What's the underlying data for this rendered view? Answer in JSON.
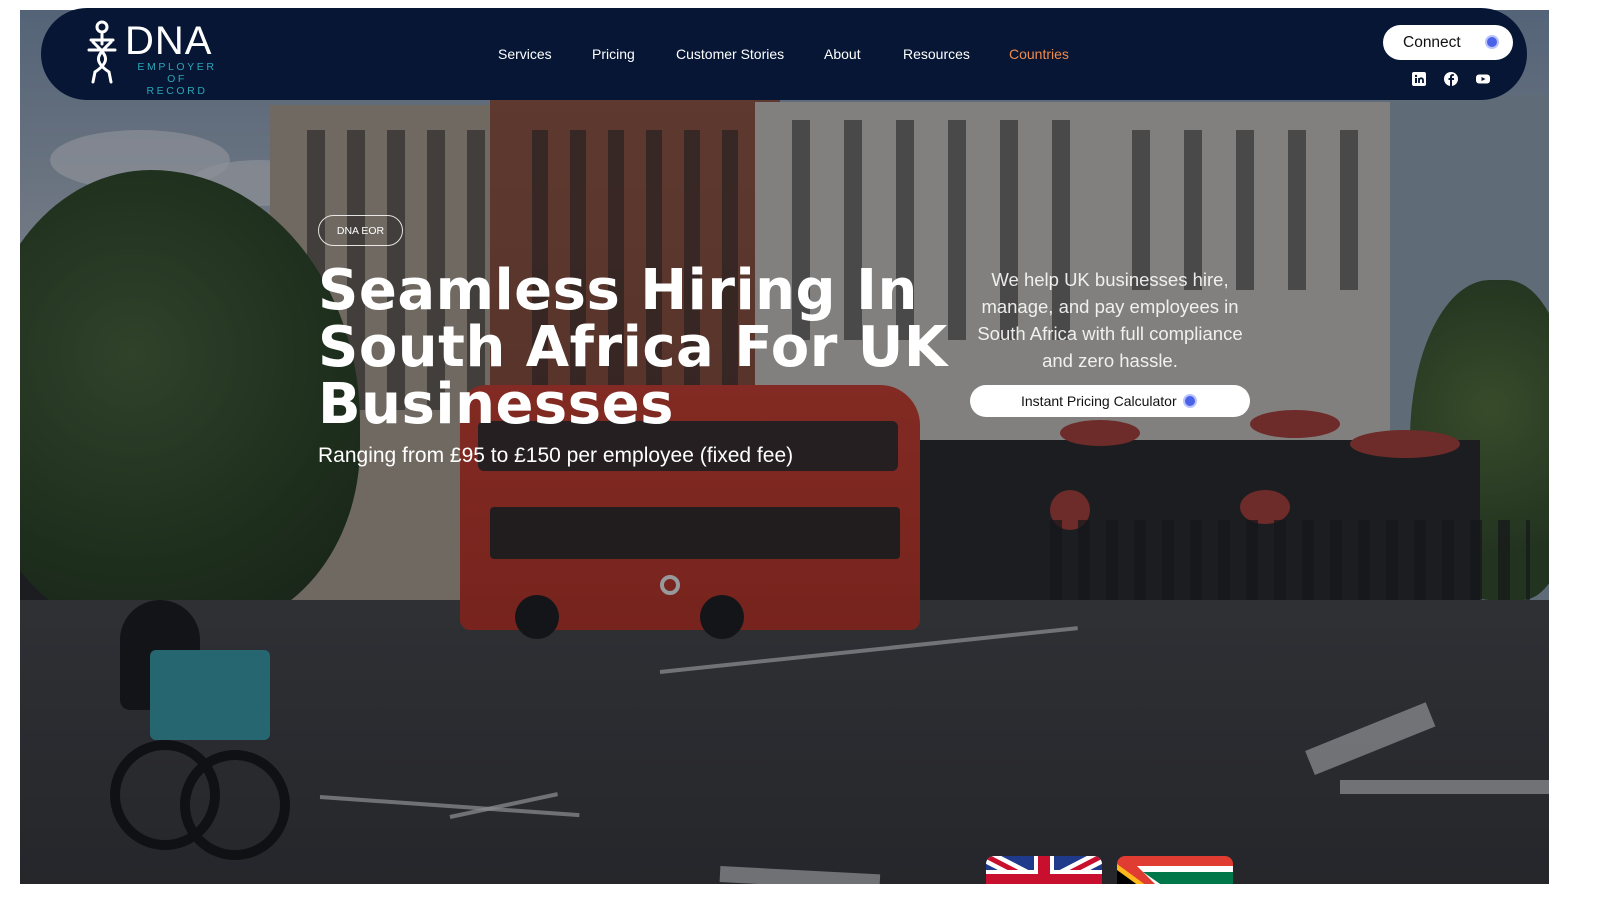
{
  "brand": {
    "name": "DNA",
    "tagline_line1": "EMPLOYER OF",
    "tagline_line2": "RECORD",
    "colors": {
      "navy": "#061634",
      "teal": "#2aa6b8",
      "accent_orange": "#f08a4b",
      "dot_blue": "#4a62e8"
    }
  },
  "nav": {
    "items": [
      {
        "label": "Services"
      },
      {
        "label": "Pricing"
      },
      {
        "label": "Customer Stories"
      },
      {
        "label": "About"
      },
      {
        "label": "Resources"
      },
      {
        "label": "Countries",
        "active": true
      }
    ],
    "connect_label": "Connect",
    "social": [
      "linkedin-icon",
      "facebook-icon",
      "youtube-icon"
    ]
  },
  "hero": {
    "badge": "DNA EOR",
    "headline": [
      "Seamless Hiring In",
      "South Africa For UK",
      "Businesses"
    ],
    "subline": "Ranging from £95 to £150 per employee (fixed fee)",
    "blurb": "We help UK businesses hire, manage, and pay employees in South Africa with full compliance and zero hassle.",
    "cta_label": "Instant Pricing Calculator"
  },
  "flags": [
    "united-kingdom-flag",
    "south-africa-flag"
  ]
}
